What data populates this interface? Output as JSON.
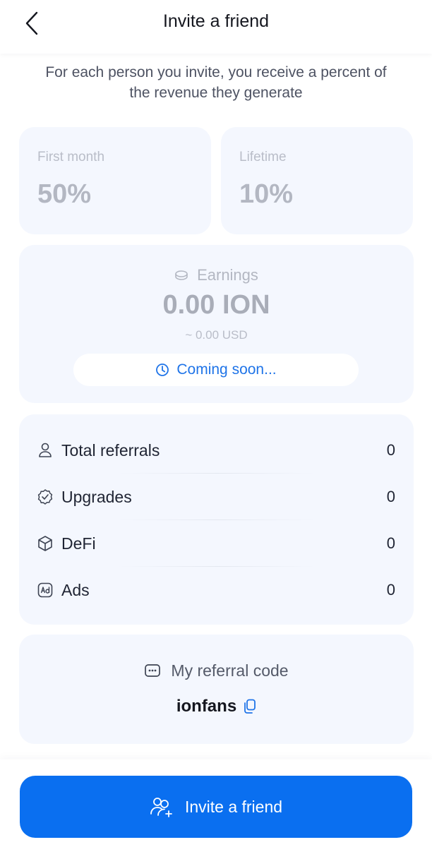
{
  "header": {
    "title": "Invite a friend",
    "back_icon": "chevron-left-icon"
  },
  "intro": {
    "text": "For each person you invite, you receive a percent of the revenue they generate"
  },
  "rates": [
    {
      "label": "First month",
      "value": "50%"
    },
    {
      "label": "Lifetime",
      "value": "10%"
    }
  ],
  "earnings": {
    "label": "Earnings",
    "icon": "coin-icon",
    "value": "0.00 ION",
    "usd": "~ 0.00 USD",
    "status": "Coming soon...",
    "status_icon": "clock-icon"
  },
  "stats": [
    {
      "label": "Total referrals",
      "value": "0",
      "icon": "user-icon"
    },
    {
      "label": "Upgrades",
      "value": "0",
      "icon": "badge-check-icon"
    },
    {
      "label": "DeFi",
      "value": "0",
      "icon": "cube-icon"
    },
    {
      "label": "Ads",
      "value": "0",
      "icon": "ad-icon"
    }
  ],
  "referral": {
    "label": "My referral code",
    "icon": "chat-dots-icon",
    "code": "ionfans",
    "copy_icon": "copy-icon"
  },
  "cta": {
    "label": "Invite a friend",
    "icon": "users-plus-icon"
  },
  "colors": {
    "accent": "#0a6ff0",
    "card_bg": "#f4f7fe",
    "link": "#1f74e8",
    "muted": "#b3b7c2"
  }
}
